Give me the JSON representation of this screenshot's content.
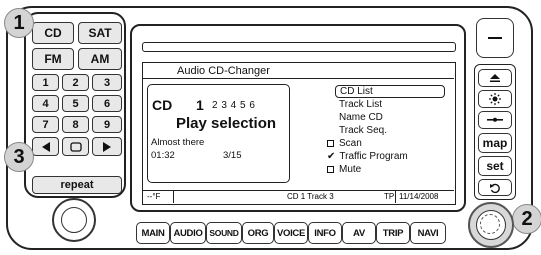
{
  "callouts": [
    "1",
    "2",
    "3"
  ],
  "keypad": {
    "cd": "CD",
    "sat": "SAT",
    "fm": "FM",
    "am": "AM",
    "digits": [
      "1",
      "2",
      "3",
      "4",
      "5",
      "6",
      "7",
      "8",
      "9"
    ],
    "repeat": "repeat"
  },
  "display": {
    "title": "Audio CD-Changer",
    "source": "CD",
    "disc_selected": "1",
    "discs": "2 3 4 5 6",
    "heading": "Play selection",
    "track_name": "Almost there",
    "time": "01:32",
    "track_count": "3/15",
    "menu": [
      {
        "label": "CD List",
        "selected": true,
        "marker": ""
      },
      {
        "label": "Track List",
        "selected": false,
        "marker": ""
      },
      {
        "label": "Name CD",
        "selected": false,
        "marker": ""
      },
      {
        "label": "Track Seq.",
        "selected": false,
        "marker": ""
      },
      {
        "label": "Scan",
        "selected": false,
        "marker": "box"
      },
      {
        "label": "Traffic Program",
        "selected": false,
        "marker": "check"
      },
      {
        "label": "Mute",
        "selected": false,
        "marker": "box"
      }
    ],
    "status": {
      "temp": "--°F",
      "track": "CD 1 Track 3",
      "tp": "TP",
      "date": "11/14/2008"
    }
  },
  "bottom_buttons": [
    "MAIN",
    "AUDIO",
    "SOUND",
    "ORG",
    "VOICE",
    "INFO",
    "AV",
    "TRIP",
    "NAVI"
  ],
  "right_buttons": {
    "map": "map",
    "set": "set"
  }
}
